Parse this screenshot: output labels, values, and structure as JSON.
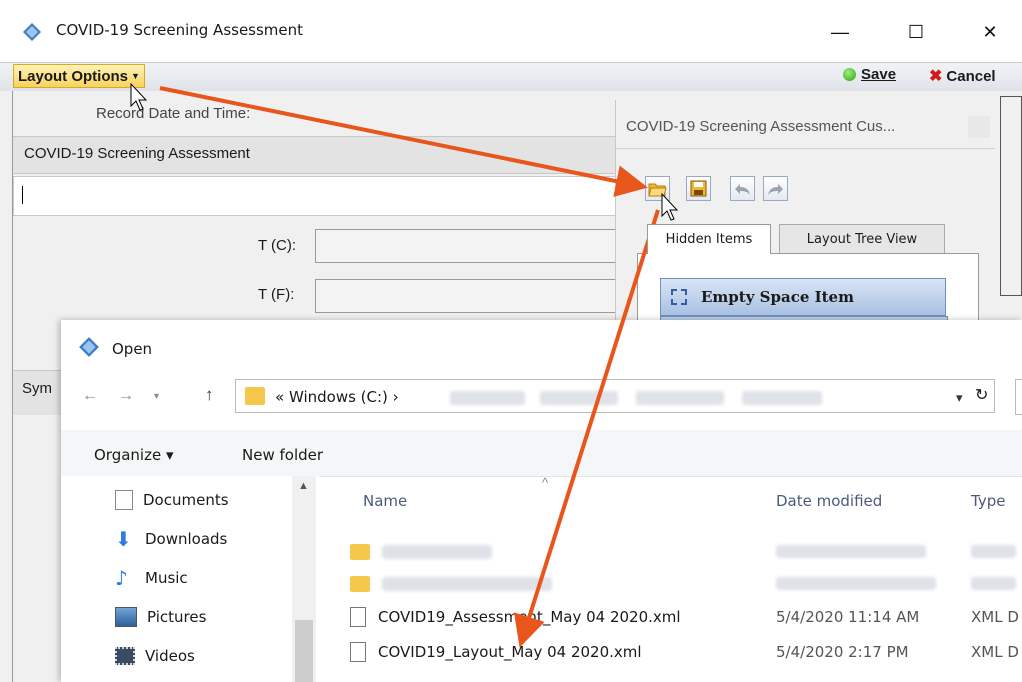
{
  "window": {
    "title": "COVID-19 Screening Assessment",
    "minimize_glyph": "—",
    "maximize_glyph": "☐",
    "close_glyph": "✕"
  },
  "toolbar": {
    "layout_options": "Layout Options",
    "save": "Save",
    "cancel": "Cancel"
  },
  "form": {
    "record_date_label": "Record Date and Time:",
    "group_title": "COVID-19 Screening Assessment",
    "temp_c_label": "T (C):",
    "temp_f_label": "T (F):",
    "symptoms_label_partial": "Sym"
  },
  "customization": {
    "title": "COVID-19 Screening Assessment Cus...",
    "tools": [
      "open-layout-icon",
      "save-layout-icon",
      "undo-icon",
      "redo-icon"
    ],
    "tabs": [
      "Hidden Items",
      "Layout Tree View"
    ],
    "hidden_item": "Empty Space Item"
  },
  "open_dialog": {
    "title": "Open",
    "address": "« Windows (C:) ›",
    "organize": "Organize ▾",
    "new_folder": "New folder",
    "nav_items": [
      "Documents",
      "Downloads",
      "Music",
      "Pictures",
      "Videos"
    ],
    "columns": {
      "name": "Name",
      "date": "Date modified",
      "type": "Type"
    },
    "files": [
      {
        "name": "COVID19_Assessment_May 04 2020.xml",
        "date": "5/4/2020 11:14 AM",
        "type": "XML D"
      },
      {
        "name": "COVID19_Layout_May 04 2020.xml",
        "date": "5/4/2020 2:17 PM",
        "type": "XML D"
      }
    ]
  },
  "colors": {
    "annotation_arrow": "#e8561c",
    "layout_button": "#f7d35c",
    "hidden_item_fill": "#a9c1e3"
  }
}
